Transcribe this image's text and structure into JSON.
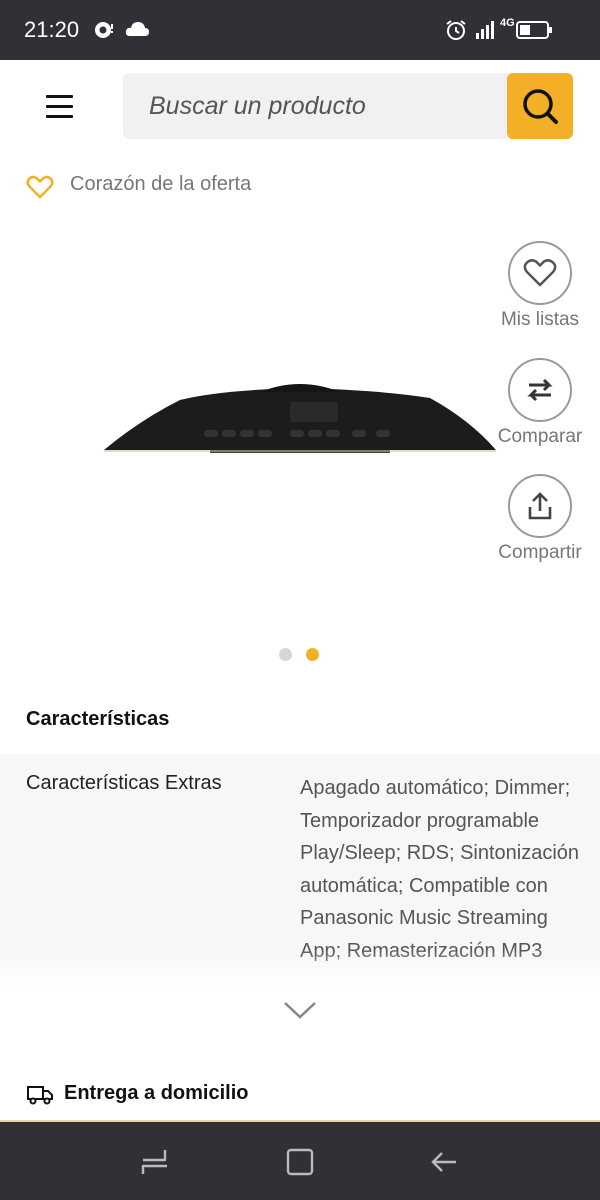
{
  "status_bar": {
    "time": "21:20",
    "left_icons": [
      "notification-icon",
      "cloud-icon"
    ],
    "right_icons": [
      "alarm-icon",
      "signal-icon",
      "network-4g-icon",
      "battery-icon"
    ],
    "network_label": "4G"
  },
  "header": {
    "menu_icon": "hamburger-menu-icon",
    "search": {
      "placeholder": "Buscar un producto",
      "value": "",
      "icon": "search-icon"
    },
    "accent_color": "#f3b027"
  },
  "offer": {
    "icon": "heart-outline-icon",
    "label": "Corazón de la oferta"
  },
  "product": {
    "image": "product-photo-audio-device",
    "actions": [
      {
        "id": "lists",
        "icon": "heart-icon",
        "label": "Mis listas"
      },
      {
        "id": "compare",
        "icon": "swap-arrows-icon",
        "label": "Comparar"
      },
      {
        "id": "share",
        "icon": "share-upload-icon",
        "label": "Compartir"
      }
    ],
    "carousel": {
      "total": 2,
      "active": 2,
      "active_color": "#f3b027",
      "inactive_color": "#d6d6d6"
    }
  },
  "features": {
    "title": "Características",
    "rows": [
      {
        "key": "Características Extras",
        "value": "Apagado automático; Dimmer; Temporizador programable Play/Sleep; RDS; Sintonización automática; Compatible con Panasonic Music Streaming App; Remasterización MP3"
      }
    ],
    "expand_icon": "chevron-down-icon"
  },
  "delivery": {
    "icon": "truck-icon",
    "label": "Entrega a domicilio"
  },
  "nav_bar": {
    "icons": [
      "recents-icon",
      "home-icon",
      "back-icon"
    ]
  }
}
